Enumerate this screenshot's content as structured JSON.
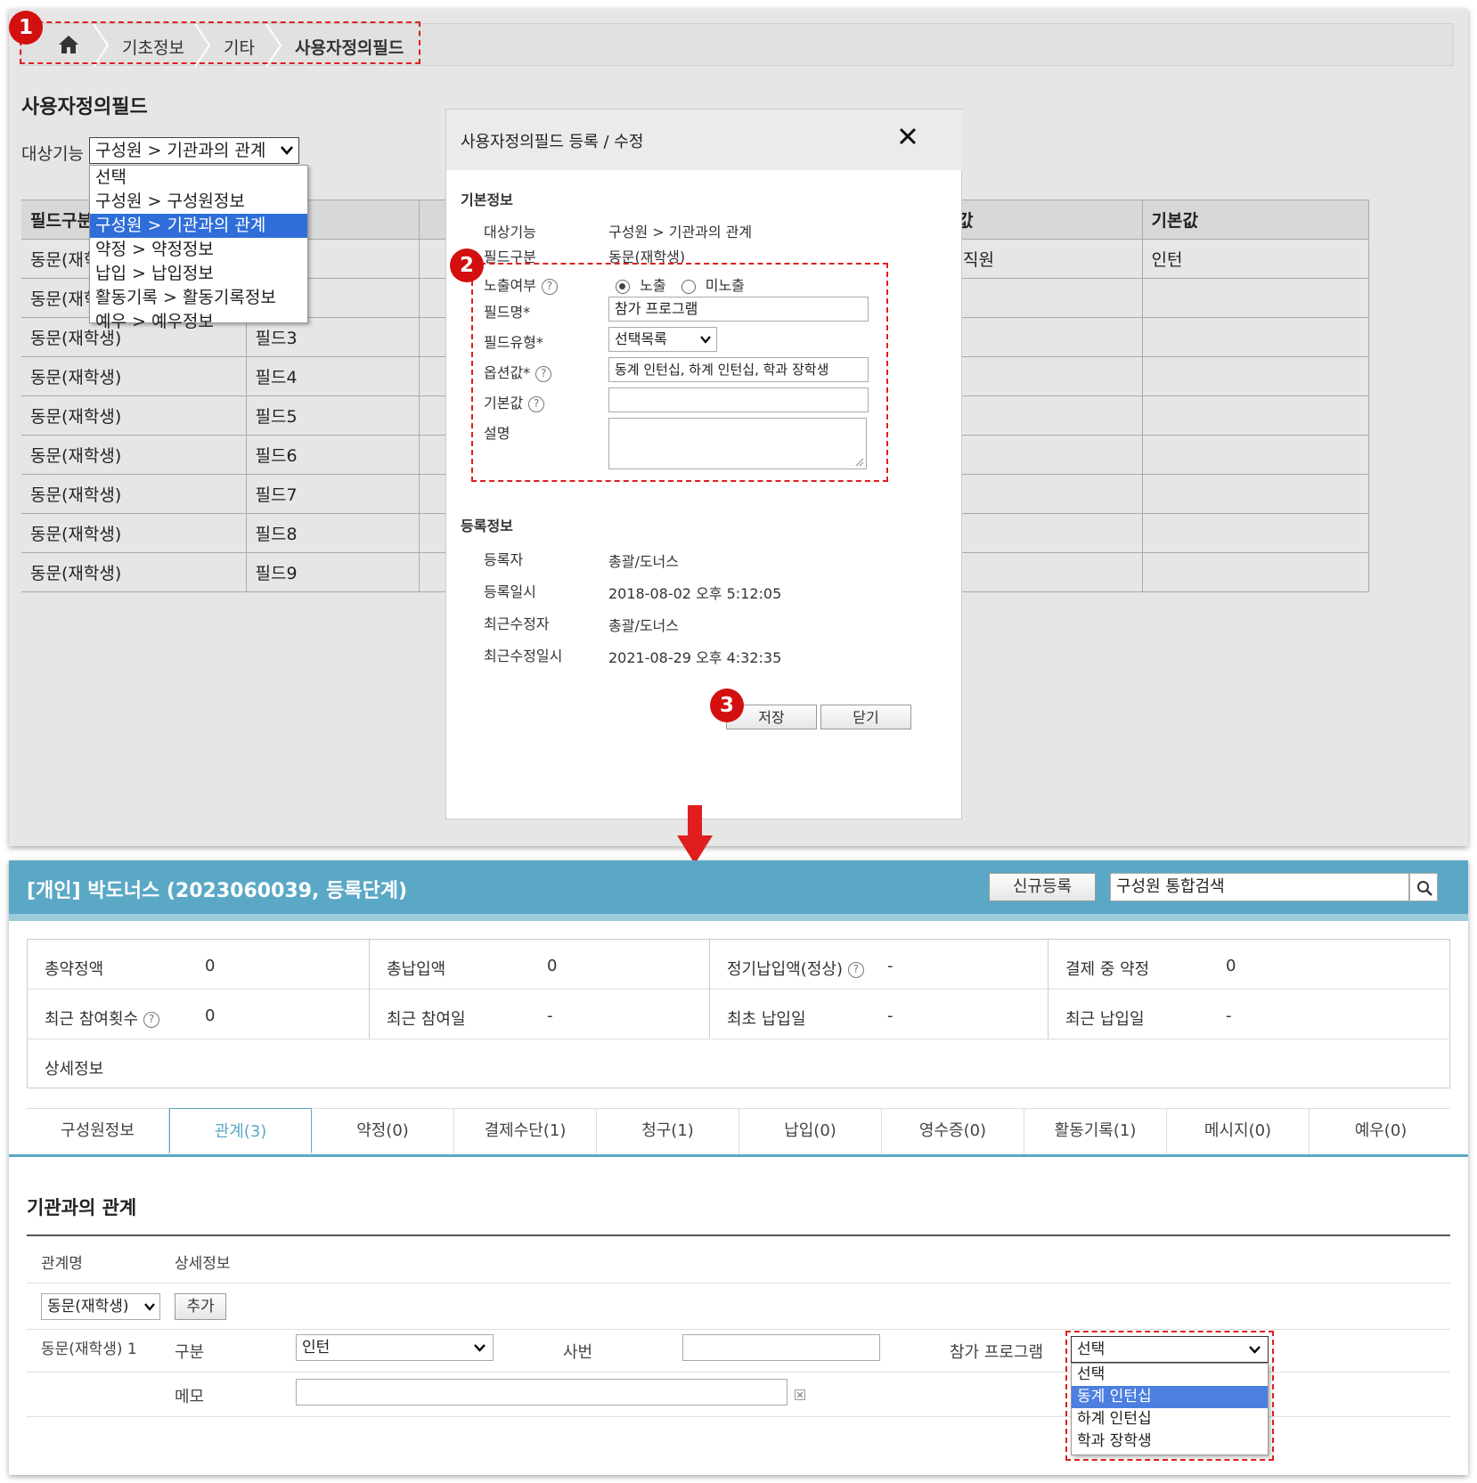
{
  "breadcrumb": {
    "home_icon": "home-icon",
    "items": [
      "기초정보",
      "기타",
      "사용자정의필드"
    ]
  },
  "markers": [
    "1",
    "2",
    "3"
  ],
  "page": {
    "title": "사용자정의필드",
    "target_label": "대상기능",
    "target_select": "구성원 > 기관과의 관계",
    "dropdown_options": [
      "선택",
      "구성원 > 구성원정보",
      "구성원 > 기관과의 관계",
      "약정 > 약정정보",
      "납입 > 납입정보",
      "활동기록 > 활동기록정보",
      "예우 > 예우정보"
    ],
    "table": {
      "headers": [
        "필드구분",
        "",
        "옵션값",
        "기본값"
      ],
      "rows": [
        [
          "동문(재학",
          "",
          "인턴,직원",
          "인턴"
        ],
        [
          "동문(재학",
          "",
          "",
          ""
        ],
        [
          "동문(재학생)",
          "필드3",
          "",
          ""
        ],
        [
          "동문(재학생)",
          "필드4",
          "",
          ""
        ],
        [
          "동문(재학생)",
          "필드5",
          "",
          ""
        ],
        [
          "동문(재학생)",
          "필드6",
          "",
          ""
        ],
        [
          "동문(재학생)",
          "필드7",
          "",
          ""
        ],
        [
          "동문(재학생)",
          "필드8",
          "",
          ""
        ],
        [
          "동문(재학생)",
          "필드9",
          "",
          ""
        ]
      ]
    }
  },
  "modal": {
    "title": "사용자정의필드 등록 / 수정",
    "close_icon": "close-icon",
    "section_basic": "기본정보",
    "target_label": "대상기능",
    "target_value": "구성원 > 기관과의 관계",
    "field_type_label": "필드구분",
    "field_type_value": "동문(재학생)",
    "expose_label": "노출여부",
    "expose_on": "노출",
    "expose_off": "미노출",
    "name_label": "필드명*",
    "name_value": "참가 프로그램",
    "kind_label": "필드유형*",
    "kind_value": "선택목록",
    "options_label": "옵션값*",
    "options_value": "동계 인턴십, 하계 인턴십, 학과 장학생",
    "default_label": "기본값",
    "default_value": "",
    "desc_label": "설명",
    "section_reg": "등록정보",
    "reg_by_label": "등록자",
    "reg_by": "총괄/도너스",
    "reg_at_label": "등록일시",
    "reg_at": "2018-08-02 오후 5:12:05",
    "mod_by_label": "최근수정자",
    "mod_by": "총괄/도너스",
    "mod_at_label": "최근수정일시",
    "mod_at": "2021-08-29 오후 4:32:35",
    "save": "저장",
    "close": "닫기"
  },
  "profile": {
    "title": "[개인] 박도너스 (2023060039, 등록단계)",
    "new_button": "신규등록",
    "search_placeholder": "구성원 통합검색",
    "summary": [
      {
        "label": "총약정액",
        "value": "0"
      },
      {
        "label": "총납입액",
        "value": "0"
      },
      {
        "label": "정기납입액(정상)",
        "value": "-"
      },
      {
        "label": "결제 중 약정",
        "value": "0"
      },
      {
        "label": "최근 참여횟수",
        "value": "0"
      },
      {
        "label": "최근 참여일",
        "value": "-"
      },
      {
        "label": "최초 납입일",
        "value": "-"
      },
      {
        "label": "최근 납입일",
        "value": "-"
      }
    ],
    "detail_label": "상세정보",
    "tabs": [
      "구성원정보",
      "관계(3)",
      "약정(0)",
      "결제수단(1)",
      "청구(1)",
      "납입(0)",
      "영수증(0)",
      "활동기록(1)",
      "메시지(0)",
      "예우(0)"
    ],
    "active_tab": 1,
    "section_title": "기관과의 관계",
    "col_rel": "관계명",
    "col_detail": "상세정보",
    "rel_select": "동문(재학생)",
    "add_button": "추가",
    "rel_name": "동문(재학생) 1",
    "gubun_label": "구분",
    "gubun_value": "인턴",
    "sabun_label": "사번",
    "program_label": "참가 프로그램",
    "program_value": "선택",
    "program_options": [
      "선택",
      "동계 인턴십",
      "하계 인턴십",
      "학과 장학생"
    ],
    "memo_label": "메모"
  },
  "colors": {
    "accent": "#5aa8c6",
    "highlight": "#e01e1e",
    "select_blue": "#2f6ed8"
  }
}
